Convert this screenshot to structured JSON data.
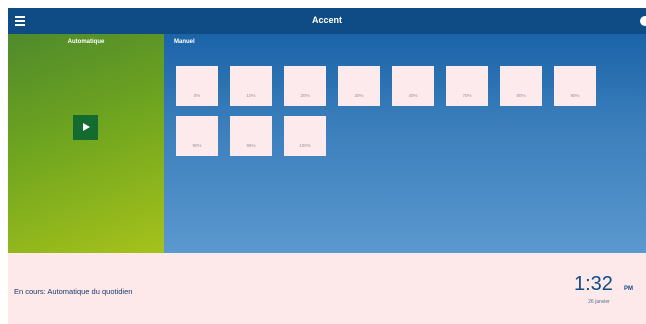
{
  "header": {
    "title": "Accent",
    "menu_icon": "hamburger-menu-icon"
  },
  "left_panel": {
    "label": "Automatique",
    "play_icon": "play-icon"
  },
  "right_panel": {
    "label": "Manuel",
    "tiles": [
      {
        "label": "0%"
      },
      {
        "label": "10%"
      },
      {
        "label": "20%"
      },
      {
        "label": "30%"
      },
      {
        "label": "40%"
      },
      {
        "label": "70%"
      },
      {
        "label": "80%"
      },
      {
        "label": "90%"
      },
      {
        "label": "90%"
      },
      {
        "label": "95%"
      },
      {
        "label": "100%"
      }
    ]
  },
  "footer": {
    "status": "En cours: Automatique du quotidien",
    "time": "1:32",
    "ampm": "PM",
    "date": "26 janvier"
  },
  "colors": {
    "header": "#0f4c86",
    "green_panel": "#6fa51f",
    "blue_panel": "#3d80bd",
    "tile": "#fdeaec",
    "footer": "#fde9ea"
  }
}
